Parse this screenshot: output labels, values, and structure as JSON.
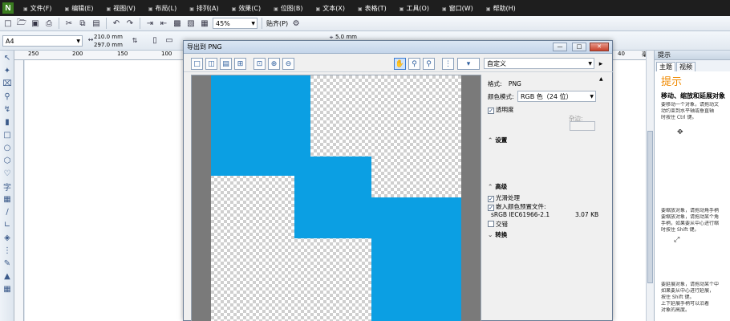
{
  "menu": [
    "文件(F)",
    "编辑(E)",
    "视图(V)",
    "布局(L)",
    "排列(A)",
    "效果(C)",
    "位图(B)",
    "文本(X)",
    "表格(T)",
    "工具(O)",
    "窗口(W)",
    "帮助(H)"
  ],
  "toolbar": {
    "zoom": "45%",
    "snap": "贴齐(P)"
  },
  "propbar": {
    "page_size": "A4",
    "width": "210.0 mm",
    "height": "297.0 mm",
    "nudge": "5.0 mm"
  },
  "ruler": {
    "ticks": [
      "250",
      "200",
      "150",
      "100",
      "50"
    ],
    "right": "40",
    "unit": "毫米"
  },
  "dialog": {
    "title": "导出到 PNG",
    "preset": "自定义",
    "options": {
      "format_label": "格式:",
      "format_value": "PNG",
      "color_mode_label": "颜色模式:",
      "color_mode_value": "RGB 色（24 位）",
      "transparency_label": "透明度",
      "matte_label": "杂边:",
      "settings_label": "设置",
      "advanced_label": "高级",
      "antialias_label": "光滑处理",
      "embed_profile_label": "嵌入颜色预置文件:",
      "profile_name": "sRGB IEC61966-2.1",
      "profile_size": "3.07 KB",
      "interlace_label": "交错",
      "transform_label": "转换"
    }
  },
  "docker": {
    "header": "提示",
    "tabs": [
      "主题",
      "视频"
    ],
    "heading": "提示",
    "subheading": "移动、缩放和延展对象",
    "lines1": [
      "要移动一个对象，请拖动文",
      "动约束到水平轴或垂直轴",
      "时按住 Ctrl 键。"
    ],
    "lines2": [
      "要缩放对象，请拖动角手柄",
      "要缩放对象，请拖动某个角",
      "手柄，如果要从中心进行缩",
      "时按住 Shift 键。"
    ],
    "lines3": [
      "要延展对象，请拖动某个中",
      "如果要从中心进行延展，",
      "按住 Shift 键。",
      "上下延展手柄可以沿着",
      "对象的高度。"
    ]
  },
  "colors": {
    "preview_fill": "#0b9fe3",
    "hint_title": "#f08a00"
  }
}
